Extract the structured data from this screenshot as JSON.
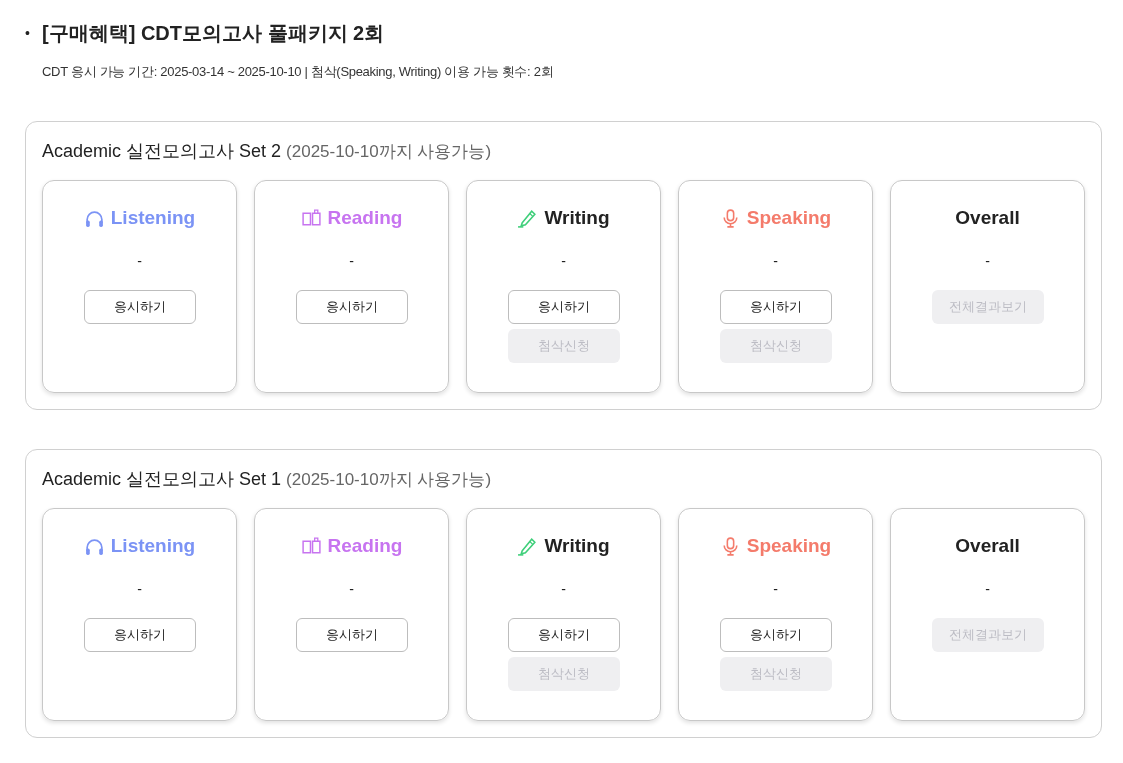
{
  "package": {
    "bullet": "•",
    "title": "[구매혜택] CDT모의고사 풀패키지 2회",
    "info": "CDT 응시 가능 기간: 2025-03-14 ~ 2025-10-10 | 첨삭(Speaking, Writing) 이용 가능 횟수: 2회"
  },
  "sets": [
    {
      "title": "Academic 실전모의고사 Set 2",
      "note": "(2025-10-10까지 사용가능)",
      "cards": [
        {
          "kind": "listening",
          "label": "Listening",
          "color": "#7b93f5",
          "score": "-",
          "buttons": [
            {
              "label": "응시하기",
              "disabled": false
            }
          ]
        },
        {
          "kind": "reading",
          "label": "Reading",
          "color": "#c774f0",
          "score": "-",
          "buttons": [
            {
              "label": "응시하기",
              "disabled": false
            }
          ]
        },
        {
          "kind": "writing",
          "label": "Writing",
          "color": "#222222",
          "score": "-",
          "buttons": [
            {
              "label": "응시하기",
              "disabled": false
            },
            {
              "label": "첨삭신청",
              "disabled": true
            }
          ]
        },
        {
          "kind": "speaking",
          "label": "Speaking",
          "color": "#f47b6b",
          "score": "-",
          "buttons": [
            {
              "label": "응시하기",
              "disabled": false
            },
            {
              "label": "첨삭신청",
              "disabled": true
            }
          ]
        },
        {
          "kind": "overall",
          "label": "Overall",
          "color": "#222222",
          "score": "-",
          "buttons": [
            {
              "label": "전체결과보기",
              "disabled": true
            }
          ]
        }
      ]
    },
    {
      "title": "Academic 실전모의고사 Set 1",
      "note": "(2025-10-10까지 사용가능)",
      "cards": [
        {
          "kind": "listening",
          "label": "Listening",
          "color": "#7b93f5",
          "score": "-",
          "buttons": [
            {
              "label": "응시하기",
              "disabled": false
            }
          ]
        },
        {
          "kind": "reading",
          "label": "Reading",
          "color": "#c774f0",
          "score": "-",
          "buttons": [
            {
              "label": "응시하기",
              "disabled": false
            }
          ]
        },
        {
          "kind": "writing",
          "label": "Writing",
          "color": "#222222",
          "score": "-",
          "buttons": [
            {
              "label": "응시하기",
              "disabled": false
            },
            {
              "label": "첨삭신청",
              "disabled": true
            }
          ]
        },
        {
          "kind": "speaking",
          "label": "Speaking",
          "color": "#f47b6b",
          "score": "-",
          "buttons": [
            {
              "label": "응시하기",
              "disabled": false
            },
            {
              "label": "첨삭신청",
              "disabled": true
            }
          ]
        },
        {
          "kind": "overall",
          "label": "Overall",
          "color": "#222222",
          "score": "-",
          "buttons": [
            {
              "label": "전체결과보기",
              "disabled": true
            }
          ]
        }
      ]
    }
  ]
}
